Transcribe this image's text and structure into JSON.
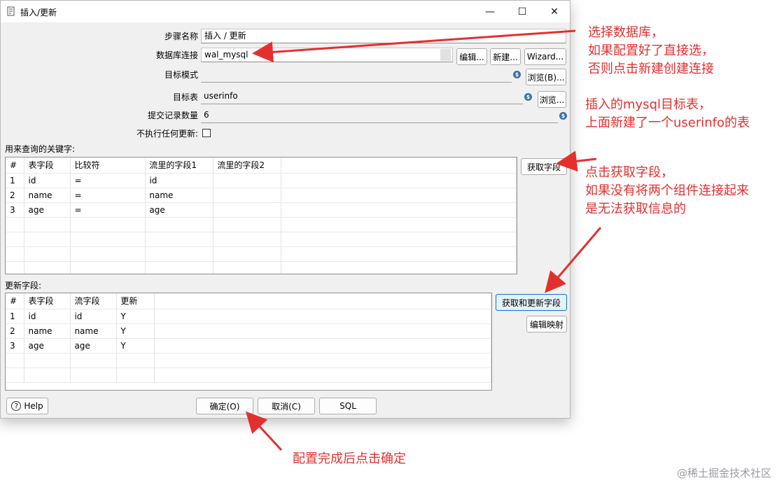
{
  "window": {
    "title": "插入/更新",
    "controls": {
      "minimize": "—",
      "maximize": "☐",
      "close": "✕"
    }
  },
  "form": {
    "step_name_label": "步骤名称",
    "step_name_value": "插入 / 更新",
    "db_conn_label": "数据库连接",
    "db_conn_value": "wal_mysql",
    "edit_btn": "编辑...",
    "new_btn": "新建...",
    "wizard_btn": "Wizard...",
    "schema_label": "目标模式",
    "schema_value": "",
    "browse_schema_btn": "浏览(B)...",
    "table_label": "目标表",
    "table_value": "userinfo",
    "browse_table_btn": "浏览...",
    "commit_label": "提交记录数量",
    "commit_value": "6",
    "no_update_label": "不执行任何更新:",
    "variable_symbol": "$"
  },
  "keys": {
    "section_label": "用来查询的关键字:",
    "get_fields_btn": "获取字段",
    "columns": [
      "#",
      "表字段",
      "比较符",
      "流里的字段1",
      "流里的字段2"
    ],
    "rows": [
      [
        "1",
        "id",
        "=",
        "id",
        ""
      ],
      [
        "2",
        "name",
        "=",
        "name",
        ""
      ],
      [
        "3",
        "age",
        "=",
        "age",
        ""
      ]
    ]
  },
  "update": {
    "section_label": "更新字段:",
    "get_update_btn": "获取和更新字段",
    "edit_mapping_btn": "编辑映射",
    "columns": [
      "#",
      "表字段",
      "流字段",
      "更新"
    ],
    "rows": [
      [
        "1",
        "id",
        "id",
        "Y"
      ],
      [
        "2",
        "name",
        "name",
        "Y"
      ],
      [
        "3",
        "age",
        "age",
        "Y"
      ]
    ]
  },
  "footer": {
    "help_btn": "Help",
    "ok_btn": "确定(O)",
    "cancel_btn": "取消(C)",
    "sql_btn": "SQL"
  },
  "annotations": {
    "db_note": [
      "选择数据库，",
      "如果配置好了直接选，",
      "否则点击新建创建连接"
    ],
    "table_note": [
      "插入的mysql目标表，",
      "上面新建了一个userinfo的表"
    ],
    "fields_note": [
      "点击获取字段，",
      "如果没有将两个组件连接起来",
      "是无法获取信息的"
    ],
    "ok_note": "配置完成后点击确定"
  },
  "watermark": "@稀土掘金技术社区",
  "colors": {
    "annotation": "#e3302f",
    "accent": "#0078d4"
  }
}
